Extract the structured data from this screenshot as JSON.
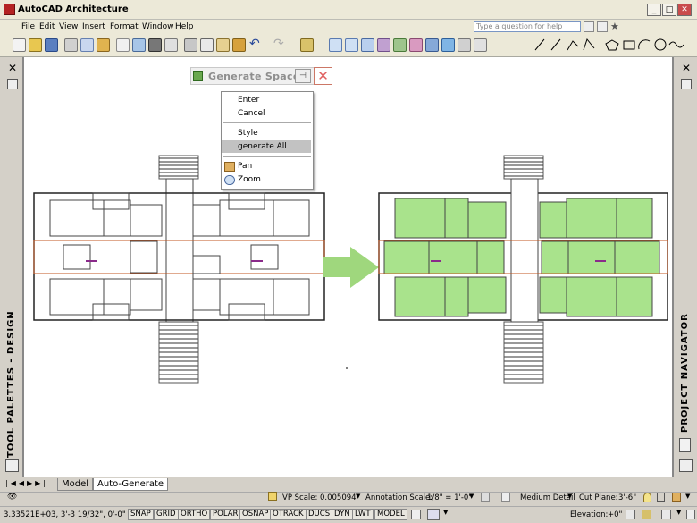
{
  "window": {
    "title": "AutoCAD Architecture"
  },
  "menu": [
    "File",
    "Edit",
    "View",
    "Insert",
    "Format",
    "Window",
    "Help"
  ],
  "help_search": {
    "placeholder": "Type a question for help"
  },
  "palettes": {
    "left": "TOOL PALETTES - DESIGN",
    "right": "PROJECT NAVIGATOR"
  },
  "floating": {
    "title": "Generate Spaces"
  },
  "context_menu": {
    "items": [
      "Enter",
      "Cancel",
      "Style",
      "generate All",
      "Pan",
      "Zoom"
    ],
    "highlighted": "generate All"
  },
  "tabs": [
    "Model",
    "Auto-Generate"
  ],
  "status_upper": {
    "vp_scale_label": "VP Scale:",
    "vp_scale": "0.005094",
    "annotation_label": "Annotation Scale:",
    "annotation": "1/8\" = 1'-0\"",
    "detail": "Medium Detail",
    "cut_label": "Cut Plane:",
    "cut": "3'-6\""
  },
  "status_lower": {
    "coords": "3.33521E+03, 3'-3 19/32\", 0'-0\"",
    "toggles": [
      "SNAP",
      "GRID",
      "ORTHO",
      "POLAR",
      "OSNAP",
      "OTRACK",
      "DUCS",
      "DYN",
      "LWT",
      "MODEL"
    ],
    "elevation_label": "Elevation:",
    "elevation": "+0\""
  },
  "colors": {
    "space_fill": "#a9e38c",
    "arrow": "#9fd77d",
    "wall": "#c0541f",
    "ctx_highlight": "#c2c2c2"
  }
}
